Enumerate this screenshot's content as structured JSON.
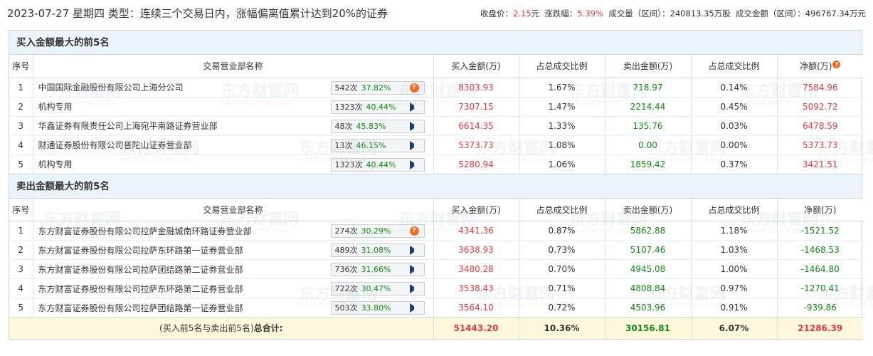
{
  "header": {
    "title": "2023-07-27 星期四 类型：连续三个交易日内，涨幅偏离值累计达到20%的证券",
    "close_label": "收盘价：",
    "close_value": "2.15",
    "close_unit": "元",
    "change_label": "涨跌幅：",
    "change_value": "5.39%",
    "volume_label": "成交量（区间）：",
    "volume_value": "240813.35万股",
    "amount_label": "成交金额（区间）：",
    "amount_value": "496767.34万元"
  },
  "watermark": {
    "text": "东方财富网",
    "subtext": "eastmoney.com"
  },
  "columns": {
    "seq": "序号",
    "name": "交易营业部名称",
    "buy": "买入金额(万)",
    "buy_ratio": "占总成交比例",
    "sell": "卖出金额(万)",
    "sell_ratio": "占总成交比例",
    "net": "净额(万)"
  },
  "buy_section": {
    "title": "买入金额最大的前5名",
    "rows": [
      {
        "seq": "1",
        "name": "中国国际金融股份有限公司上海分公司",
        "times": "542次",
        "win_rate": "37.82%",
        "action": "question",
        "buy": "8303.93",
        "buy_ratio": "1.67%",
        "sell": "718.97",
        "sell_ratio": "0.14%",
        "net": "7584.96",
        "net_color": "red"
      },
      {
        "seq": "2",
        "name": "机构专用",
        "times": "1323次",
        "win_rate": "40.44%",
        "action": "arrow",
        "buy": "7307.15",
        "buy_ratio": "1.47%",
        "sell": "2214.44",
        "sell_ratio": "0.45%",
        "net": "5092.72",
        "net_color": "red"
      },
      {
        "seq": "3",
        "name": "华鑫证券有限责任公司上海宛平南路证券营业部",
        "times": "48次",
        "win_rate": "45.83%",
        "action": "arrow",
        "buy": "6614.35",
        "buy_ratio": "1.33%",
        "sell": "135.76",
        "sell_ratio": "0.03%",
        "net": "6478.59",
        "net_color": "red"
      },
      {
        "seq": "4",
        "name": "财通证券股份有限公司普陀山证券营业部",
        "times": "13次",
        "win_rate": "46.15%",
        "action": "arrow",
        "buy": "5373.73",
        "buy_ratio": "1.08%",
        "sell": "0.00",
        "sell_ratio": "0.00%",
        "net": "5373.73",
        "net_color": "red"
      },
      {
        "seq": "5",
        "name": "机构专用",
        "times": "1323次",
        "win_rate": "40.44%",
        "action": "arrow",
        "buy": "5280.94",
        "buy_ratio": "1.06%",
        "sell": "1859.42",
        "sell_ratio": "0.37%",
        "net": "3421.51",
        "net_color": "red"
      }
    ]
  },
  "sell_section": {
    "title": "卖出金额最大的前5名",
    "rows": [
      {
        "seq": "1",
        "name": "东方财富证券股份有限公司拉萨金融城南环路证券营业部",
        "times": "274次",
        "win_rate": "30.29%",
        "action": "question",
        "buy": "4341.36",
        "buy_ratio": "0.87%",
        "sell": "5862.88",
        "sell_ratio": "1.18%",
        "net": "-1521.52",
        "net_color": "green"
      },
      {
        "seq": "2",
        "name": "东方财富证券股份有限公司拉萨东环路第一证券营业部",
        "times": "489次",
        "win_rate": "31.08%",
        "action": "arrow",
        "buy": "3638.93",
        "buy_ratio": "0.73%",
        "sell": "5107.46",
        "sell_ratio": "1.03%",
        "net": "-1468.53",
        "net_color": "green"
      },
      {
        "seq": "3",
        "name": "东方财富证券股份有限公司拉萨团结路第二证券营业部",
        "times": "736次",
        "win_rate": "31.66%",
        "action": "arrow",
        "buy": "3480.28",
        "buy_ratio": "0.70%",
        "sell": "4945.08",
        "sell_ratio": "1.00%",
        "net": "-1464.80",
        "net_color": "green"
      },
      {
        "seq": "4",
        "name": "东方财富证券股份有限公司拉萨东环路第二证券营业部",
        "times": "722次",
        "win_rate": "30.47%",
        "action": "arrow",
        "buy": "3538.43",
        "buy_ratio": "0.71%",
        "sell": "4808.84",
        "sell_ratio": "0.97%",
        "net": "-1270.41",
        "net_color": "green"
      },
      {
        "seq": "5",
        "name": "东方财富证券股份有限公司拉萨团结路第一证券营业部",
        "times": "503次",
        "win_rate": "33.80%",
        "action": "arrow",
        "buy": "3564.10",
        "buy_ratio": "0.72%",
        "sell": "4503.96",
        "sell_ratio": "0.91%",
        "net": "-939.86",
        "net_color": "green"
      }
    ]
  },
  "total": {
    "label_prefix": "(买入前5名与卖出前5名)",
    "label_bold": "总合计:",
    "buy": "51443.20",
    "buy_ratio": "10.36%",
    "sell": "30156.81",
    "sell_ratio": "6.07%",
    "net": "21286.39"
  },
  "colors": {
    "up": "#e4393c",
    "down": "#118811",
    "section_bg": "#edf3fa",
    "border": "#c9d6e6",
    "total_bg": "#fff8dc",
    "icon_orange": "#ef6c22",
    "arrow_navy": "#1d3f73"
  }
}
